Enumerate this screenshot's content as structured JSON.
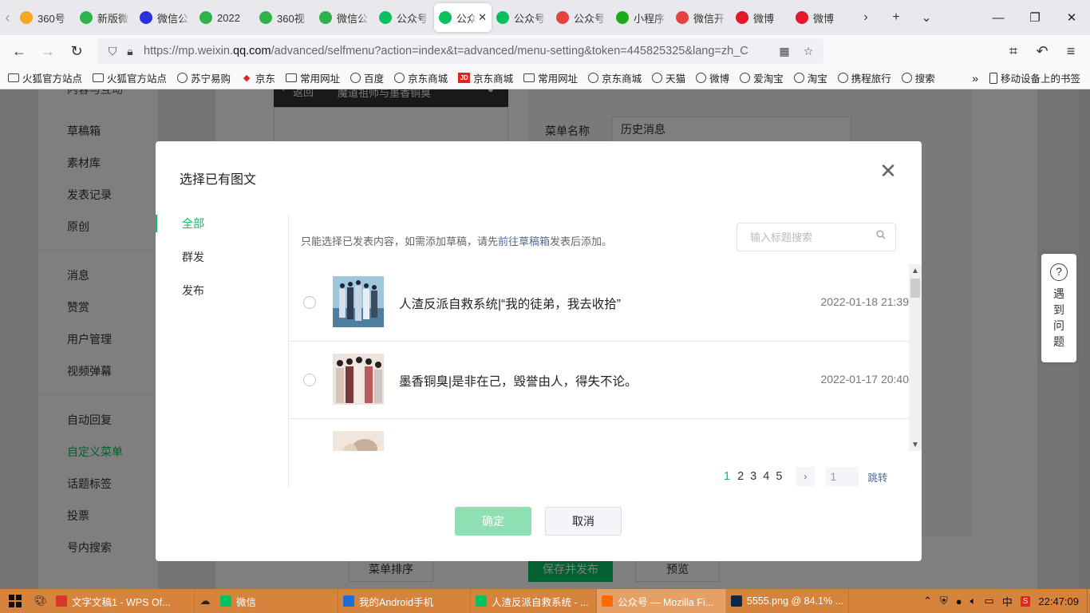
{
  "browser": {
    "tabs": [
      {
        "title": "360号",
        "icon": "360-icon",
        "color": "#f5a623"
      },
      {
        "title": "新版微",
        "icon": "search-o-icon",
        "color": "#2db34a"
      },
      {
        "title": "微信公",
        "icon": "paw-icon",
        "color": "#2932e1"
      },
      {
        "title": "2022",
        "icon": "search-o-icon",
        "color": "#2db34a"
      },
      {
        "title": "360视",
        "icon": "search-o-icon",
        "color": "#2db34a"
      },
      {
        "title": "微信公",
        "icon": "search-o-icon",
        "color": "#2db34a"
      },
      {
        "title": "公众号",
        "icon": "wechat-mp-icon",
        "color": "#07c160"
      },
      {
        "title": "公众",
        "icon": "wechat-mp-icon",
        "color": "#07c160",
        "active": true
      },
      {
        "title": "公众号",
        "icon": "wechat-mp-icon",
        "color": "#07c160"
      },
      {
        "title": "公众号",
        "icon": "dots-icon",
        "color": "#e64340"
      },
      {
        "title": "小程序",
        "icon": "dots-icon",
        "color": "#1aad19"
      },
      {
        "title": "微信开",
        "icon": "dots-icon",
        "color": "#e64340"
      },
      {
        "title": "微博",
        "icon": "weibo-icon",
        "color": "#e6162d"
      },
      {
        "title": "微博",
        "icon": "weibo-icon",
        "color": "#e6162d"
      }
    ],
    "url_prefix": "https://mp.weixin.",
    "url_host": "qq.com",
    "url_rest": "/advanced/selfmenu?action=index&t=advanced/menu-setting&token=445825325&lang=zh_C",
    "bookmarks": [
      {
        "label": "火狐官方站点",
        "icon": "folder"
      },
      {
        "label": "火狐官方站点",
        "icon": "folder"
      },
      {
        "label": "苏宁易购",
        "icon": "globe"
      },
      {
        "label": "京东",
        "icon": "jd-dog"
      },
      {
        "label": "常用网址",
        "icon": "folder"
      },
      {
        "label": "百度",
        "icon": "globe"
      },
      {
        "label": "京东商城",
        "icon": "globe"
      },
      {
        "label": "京东商城",
        "icon": "jd"
      },
      {
        "label": "常用网址",
        "icon": "folder"
      },
      {
        "label": "京东商城",
        "icon": "globe"
      },
      {
        "label": "天猫",
        "icon": "globe"
      },
      {
        "label": "微博",
        "icon": "globe"
      },
      {
        "label": "爱淘宝",
        "icon": "globe"
      },
      {
        "label": "淘宝",
        "icon": "globe"
      },
      {
        "label": "携程旅行",
        "icon": "globe"
      },
      {
        "label": "搜索",
        "icon": "globe"
      }
    ],
    "jd_badge": "JD",
    "mobile_bookmarks": "移动设备上的书签"
  },
  "page": {
    "sidebar_items": [
      "草稿箱",
      "素材库",
      "发表记录",
      "原创",
      "消息",
      "赞赏",
      "用户管理",
      "视频弹幕",
      "自动回复",
      "自定义菜单",
      "话题标签",
      "投票",
      "号内搜索"
    ],
    "sidebar_section": "内容与互动",
    "active_sidebar": "自定义菜单",
    "phone_back": "返回",
    "phone_title": "魔道祖师与墨香铜臭",
    "menu_name_label": "菜单名称",
    "menu_name_value": "历史消息",
    "btn_sort": "菜单排序",
    "btn_save": "保存并发布",
    "btn_preview": "预览",
    "help_text": "遇到问题"
  },
  "dialog": {
    "title": "选择已有图文",
    "nav": [
      "全部",
      "群发",
      "发布"
    ],
    "hint_before": "只能选择已发表内容，如需添加草稿，请先",
    "hint_link": "前往草稿箱",
    "hint_after": "发表后添加。",
    "search_placeholder": "输入标题搜索",
    "articles": [
      {
        "title": "人渣反派自救系统|“我的徒弟，我去收拾”",
        "date": "2022-01-18 21:39"
      },
      {
        "title": "墨香铜臭|是非在己，毁誉由人，得失不论。",
        "date": "2022-01-17 20:40"
      },
      {
        "title": "",
        "date": ""
      }
    ],
    "pages": [
      "1",
      "2",
      "3",
      "4",
      "5"
    ],
    "current_page": "1",
    "page_input": "1",
    "jump": "跳转",
    "ok": "确定",
    "cancel": "取消"
  },
  "taskbar": {
    "tasks": [
      {
        "label": "文字文稿1 - WPS Of...",
        "icon": "wps-icon",
        "color": "#d9362b"
      },
      {
        "label": "微信",
        "icon": "wechat-icon",
        "color": "#07c160"
      },
      {
        "label": "我的Android手机",
        "icon": "phone-icon",
        "color": "#1e6ed8"
      },
      {
        "label": "人渣反派自救系统 - ...",
        "icon": "wechat-mp-icon",
        "color": "#07c160"
      },
      {
        "label": "公众号 — Mozilla Fi...",
        "icon": "firefox-icon",
        "color": "#ff6a00",
        "active": true
      },
      {
        "label": "5555.png @ 84.1% ...",
        "icon": "photoshop-icon",
        "color": "#0a2a4a"
      }
    ],
    "ime": "中",
    "time": "22:47:09"
  }
}
